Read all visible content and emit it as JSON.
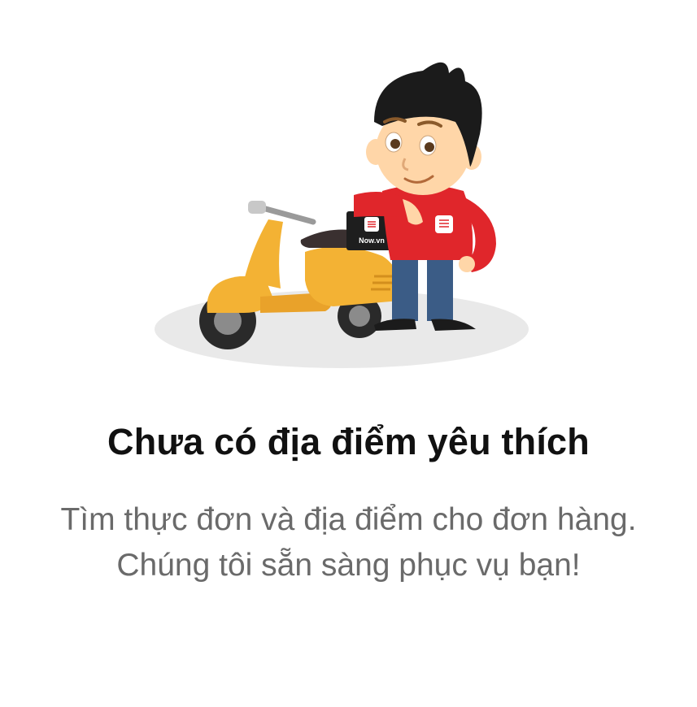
{
  "illustration": {
    "icon": "delivery-man-with-scooter-illustration",
    "box_label": "Now.vn",
    "colors": {
      "scooter": "#f3b234",
      "shirt": "#e0262b",
      "pants": "#3b5c86",
      "hair": "#1b1b1b",
      "skin": "#ffd6a8",
      "shadow": "#e9e9e9"
    }
  },
  "empty_state": {
    "title": "Chưa có địa điểm yêu thích",
    "line1": "Tìm thực đơn và địa điểm cho đơn hàng.",
    "line2": "Chúng tôi sẵn sàng phục vụ bạn!"
  }
}
